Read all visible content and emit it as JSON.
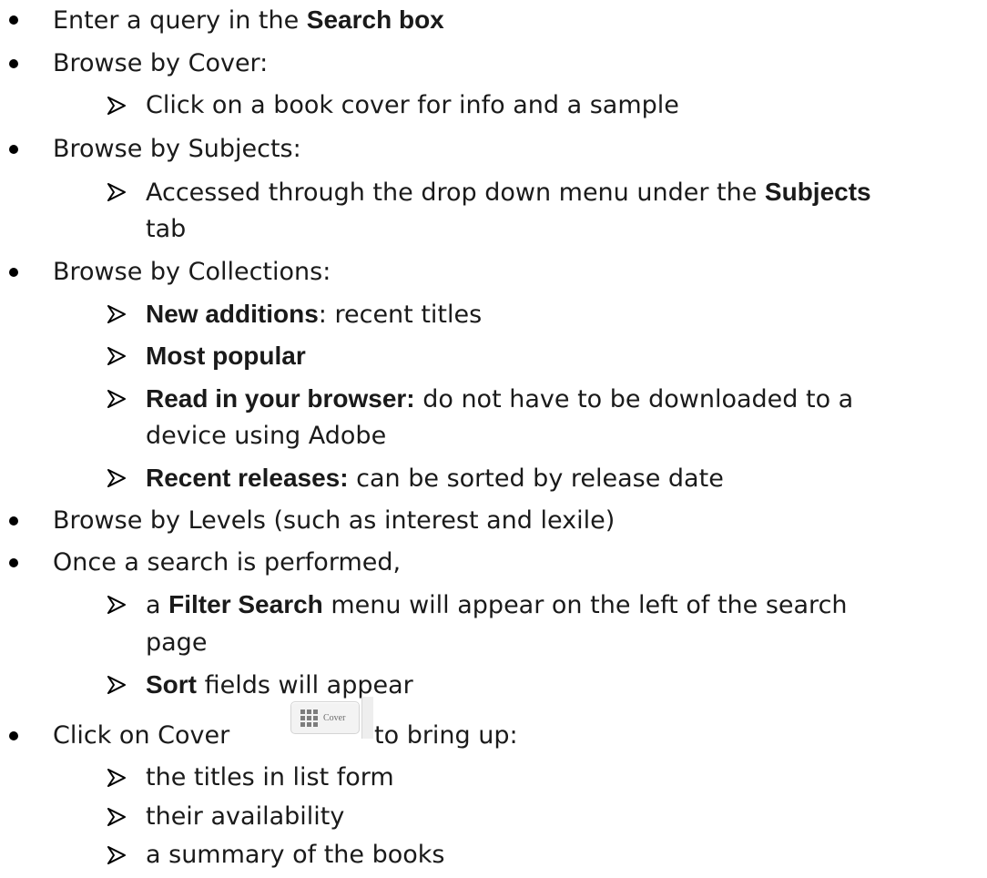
{
  "items": [
    {
      "pre": "Enter a query in the ",
      "bold": "Search box",
      "post": ""
    },
    {
      "text": "Browse by Cover:"
    },
    {
      "sub": "Click on a book cover for info and a sample"
    },
    {
      "text": "Browse by Subjects:"
    },
    {
      "sub_pre": "Accessed through the drop down menu under the ",
      "sub_bold": "Subjects",
      "sub_cont": "tab"
    },
    {
      "text": "Browse by Collections:"
    },
    {
      "bold": "New additions",
      "post": ": recent titles"
    },
    {
      "bold": "Most popular"
    },
    {
      "bold": "Read in your browser:",
      "post": " do not have to be downloaded to a",
      "cont": "device using Adobe"
    },
    {
      "bold": "Recent releases:",
      "post": " can be sorted by release date"
    },
    {
      "text": "Browse by Levels (such as interest and lexile)"
    },
    {
      "text": "Once a search is performed,"
    },
    {
      "pre": "a ",
      "bold": "Filter Search",
      "post": " menu will appear on the left of the search",
      "cont": "page"
    },
    {
      "bold": "Sort",
      "post": " fields will appear"
    },
    {
      "pre": "Click on Cover",
      "post": "to bring up:",
      "button_label": "Cover"
    },
    {
      "sub": "the titles in list form"
    },
    {
      "sub": "their availability"
    },
    {
      "sub": "a summary of the books"
    }
  ]
}
